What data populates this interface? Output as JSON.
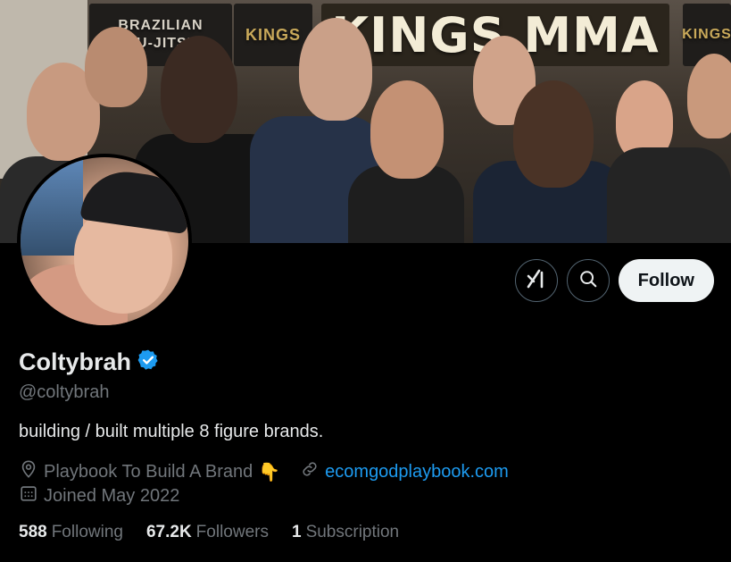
{
  "banner": {
    "sign_main": "KINGS MMA",
    "sign_left_line1": "BRAZILIAN",
    "sign_left_line2": "JIU-JITSU",
    "sign_logo": "KINGS"
  },
  "profile": {
    "display_name": "Coltybrah",
    "handle": "@coltybrah",
    "bio": "building / built multiple 8 figure brands.",
    "location": "Playbook To Build A Brand",
    "location_emoji": "👇",
    "website": "ecomgodplaybook.com",
    "joined": "Joined May 2022",
    "verified_color": "#1d9bf0"
  },
  "actions": {
    "follow_label": "Follow",
    "grok_icon": "grok-icon",
    "search_icon": "search-icon"
  },
  "stats": {
    "following_count": "588",
    "following_label": "Following",
    "followers_count": "67.2K",
    "followers_label": "Followers",
    "subscription_count": "1",
    "subscription_label": "Subscription"
  },
  "colors": {
    "background": "#000000",
    "text_primary": "#e7e9ea",
    "text_secondary": "#71767b",
    "accent": "#1d9bf0"
  }
}
